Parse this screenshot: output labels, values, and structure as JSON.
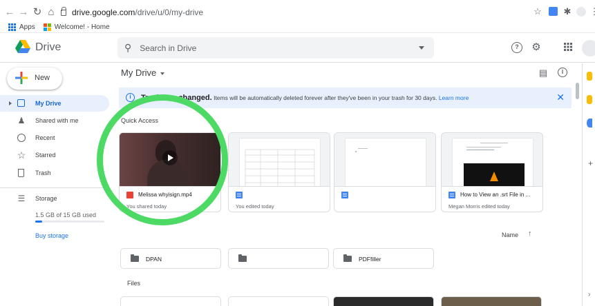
{
  "browser": {
    "url_host": "drive.google.com",
    "url_path": "/drive/u/0/my-drive",
    "bookmarks": [
      {
        "label": "Apps"
      },
      {
        "label": "Welcome! - Home"
      }
    ]
  },
  "header": {
    "app_name": "Drive",
    "search_placeholder": "Search in Drive"
  },
  "sidebar": {
    "new_label": "New",
    "items": [
      {
        "label": "My Drive",
        "icon": "drive-icon",
        "active": true
      },
      {
        "label": "Shared with me",
        "icon": "people-icon"
      },
      {
        "label": "Recent",
        "icon": "clock-icon"
      },
      {
        "label": "Starred",
        "icon": "star-icon"
      },
      {
        "label": "Trash",
        "icon": "trash-icon"
      },
      {
        "label": "Storage",
        "icon": "storage-icon"
      }
    ],
    "storage_used": "1.5 GB of 15 GB used",
    "storage_fraction": 0.1,
    "buy_storage": "Buy storage"
  },
  "main": {
    "title": "My Drive",
    "banner": {
      "title": "Trash has changed.",
      "text": "Items will be automatically deleted forever after they've been in your trash for 30 days.",
      "link": "Learn more"
    },
    "quick_access_label": "Quick Access",
    "quick_access": [
      {
        "title": "Melissa whyisign.mp4",
        "meta": "You shared today",
        "type": "video"
      },
      {
        "title": "",
        "meta": "You edited today",
        "type": "doc"
      },
      {
        "title": "",
        "meta": "",
        "type": "doc"
      },
      {
        "title": "How to View an .srt File in ...",
        "meta": "Megan Morris edited today",
        "type": "doc"
      }
    ],
    "sort_label": "Name",
    "folders": [
      {
        "name": "DPAN"
      },
      {
        "name": ""
      },
      {
        "name": "PDFfiller"
      }
    ],
    "files_label": "Files"
  },
  "colors": {
    "accent": "#1a73e8",
    "active_bg": "#e8f0fe",
    "annotation_circle": "#4cd964"
  }
}
